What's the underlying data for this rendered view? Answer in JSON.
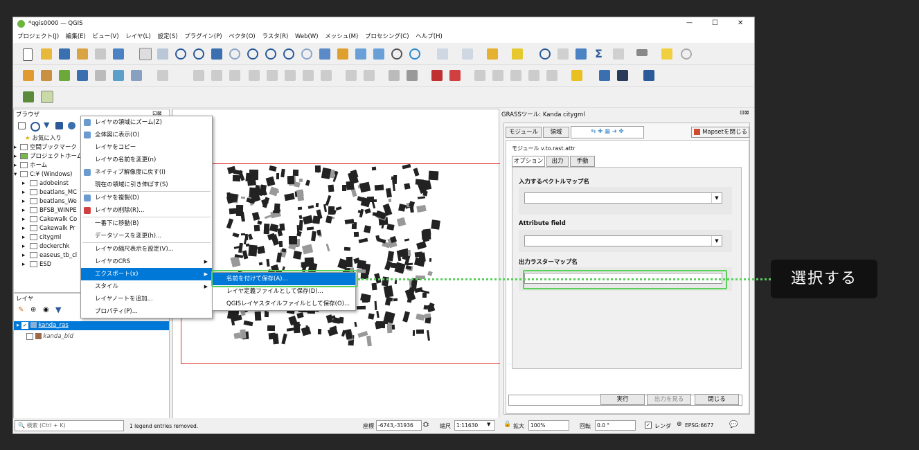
{
  "window": {
    "title": "*qgis0000 — QGIS",
    "controls": {
      "minimize": "—",
      "maximize": "☐",
      "close": "✕"
    }
  },
  "menubar": [
    "プロジェクト(J)",
    "編集(E)",
    "ビュー(V)",
    "レイヤ(L)",
    "設定(S)",
    "プラグイン(P)",
    "ベクタ(O)",
    "ラスタ(R)",
    "Web(W)",
    "メッシュ(M)",
    "プロセシング(C)",
    "ヘルプ(H)"
  ],
  "browser": {
    "title": "ブラウザ",
    "items": [
      {
        "label": "お気に入り",
        "icon": "star-icon"
      },
      {
        "label": "空間ブックマーク",
        "icon": "bookmark-icon"
      },
      {
        "label": "プロジェクトホーム",
        "icon": "project-home-icon"
      },
      {
        "label": "ホーム",
        "icon": "home-icon"
      },
      {
        "label": "C:¥ (Windows)",
        "icon": "drive-icon"
      },
      {
        "label": "adobeinst"
      },
      {
        "label": "beatlans_MC"
      },
      {
        "label": "beatlans_We"
      },
      {
        "label": "BFSB_WINPE"
      },
      {
        "label": "Cakewalk Co"
      },
      {
        "label": "Cakewalk Pr"
      },
      {
        "label": "citygml"
      },
      {
        "label": "dockerchk"
      },
      {
        "label": "easeus_tb_cl"
      },
      {
        "label": "ESD"
      }
    ]
  },
  "layers": {
    "title": "レイヤ",
    "items": [
      {
        "label": "kanda_ras",
        "checked": true
      },
      {
        "label": "kanda_bld",
        "checked": false
      }
    ]
  },
  "context_menu": [
    {
      "label": "レイヤの領域にズーム(Z)",
      "icon": "zoom-layer-icon"
    },
    {
      "label": "全体図に表示(O)",
      "icon": "overview-icon"
    },
    {
      "label": "レイヤをコピー"
    },
    {
      "label": "レイヤの名前を変更(n)"
    },
    {
      "label": "ネイティブ解像度に戻す(I)",
      "icon": "native-res-icon"
    },
    {
      "label": "現在の領域に引き伸ばす(S)"
    },
    {
      "sep": true
    },
    {
      "label": "レイヤを複製(D)",
      "icon": "duplicate-icon"
    },
    {
      "label": "レイヤの削除(R)...",
      "icon": "remove-icon"
    },
    {
      "sep": true
    },
    {
      "label": "一番下に移動(B)"
    },
    {
      "label": "データソースを変更(h)..."
    },
    {
      "sep": true
    },
    {
      "label": "レイヤの縮尺表示を設定(V)..."
    },
    {
      "label": "レイヤのCRS",
      "submenu": true
    },
    {
      "label": "エクスポート(x)",
      "submenu": true,
      "highlight": true
    },
    {
      "label": "スタイル",
      "submenu": true
    },
    {
      "label": "レイヤノートを追加..."
    },
    {
      "label": "プロパティ(P)..."
    }
  ],
  "submenu": [
    {
      "label": "名前を付けて保存(A)...",
      "highlight": true
    },
    {
      "label": "レイヤ定義ファイルとして保存(D)..."
    },
    {
      "label": "QGISレイヤスタイルファイルとして保存(O)..."
    }
  ],
  "grass": {
    "title": "GRASSツール: Kanda citygml",
    "tabs": [
      "モジュール",
      "領域"
    ],
    "mapset_button": "Mapsetを閉じる",
    "module_label": "モジュール v.to.rast.attr",
    "subtabs": [
      "オプション",
      "出力",
      "手動"
    ],
    "fields": [
      {
        "label": "入力するベクトルマップ名"
      },
      {
        "label": "Attribute field"
      },
      {
        "label": "出力ラスターマップ名"
      }
    ],
    "buttons": {
      "run": "実行",
      "view_output": "出力を見る",
      "close": "閉じる"
    }
  },
  "statusbar": {
    "search_placeholder": "検索 (Ctrl + K)",
    "message": "1 legend entries removed.",
    "coord_label": "座標",
    "coord_value": "-6743,-31936",
    "scale_label": "縮尺",
    "scale_value": "1:11630",
    "magnifier_label": "拡大",
    "magnifier_value": "100%",
    "rotation_label": "回転",
    "rotation_value": "0.0 °",
    "render_label": "レンダ",
    "crs": "EPSG:6677"
  },
  "callout": {
    "text": "選択する",
    "color": "#58d05a"
  }
}
